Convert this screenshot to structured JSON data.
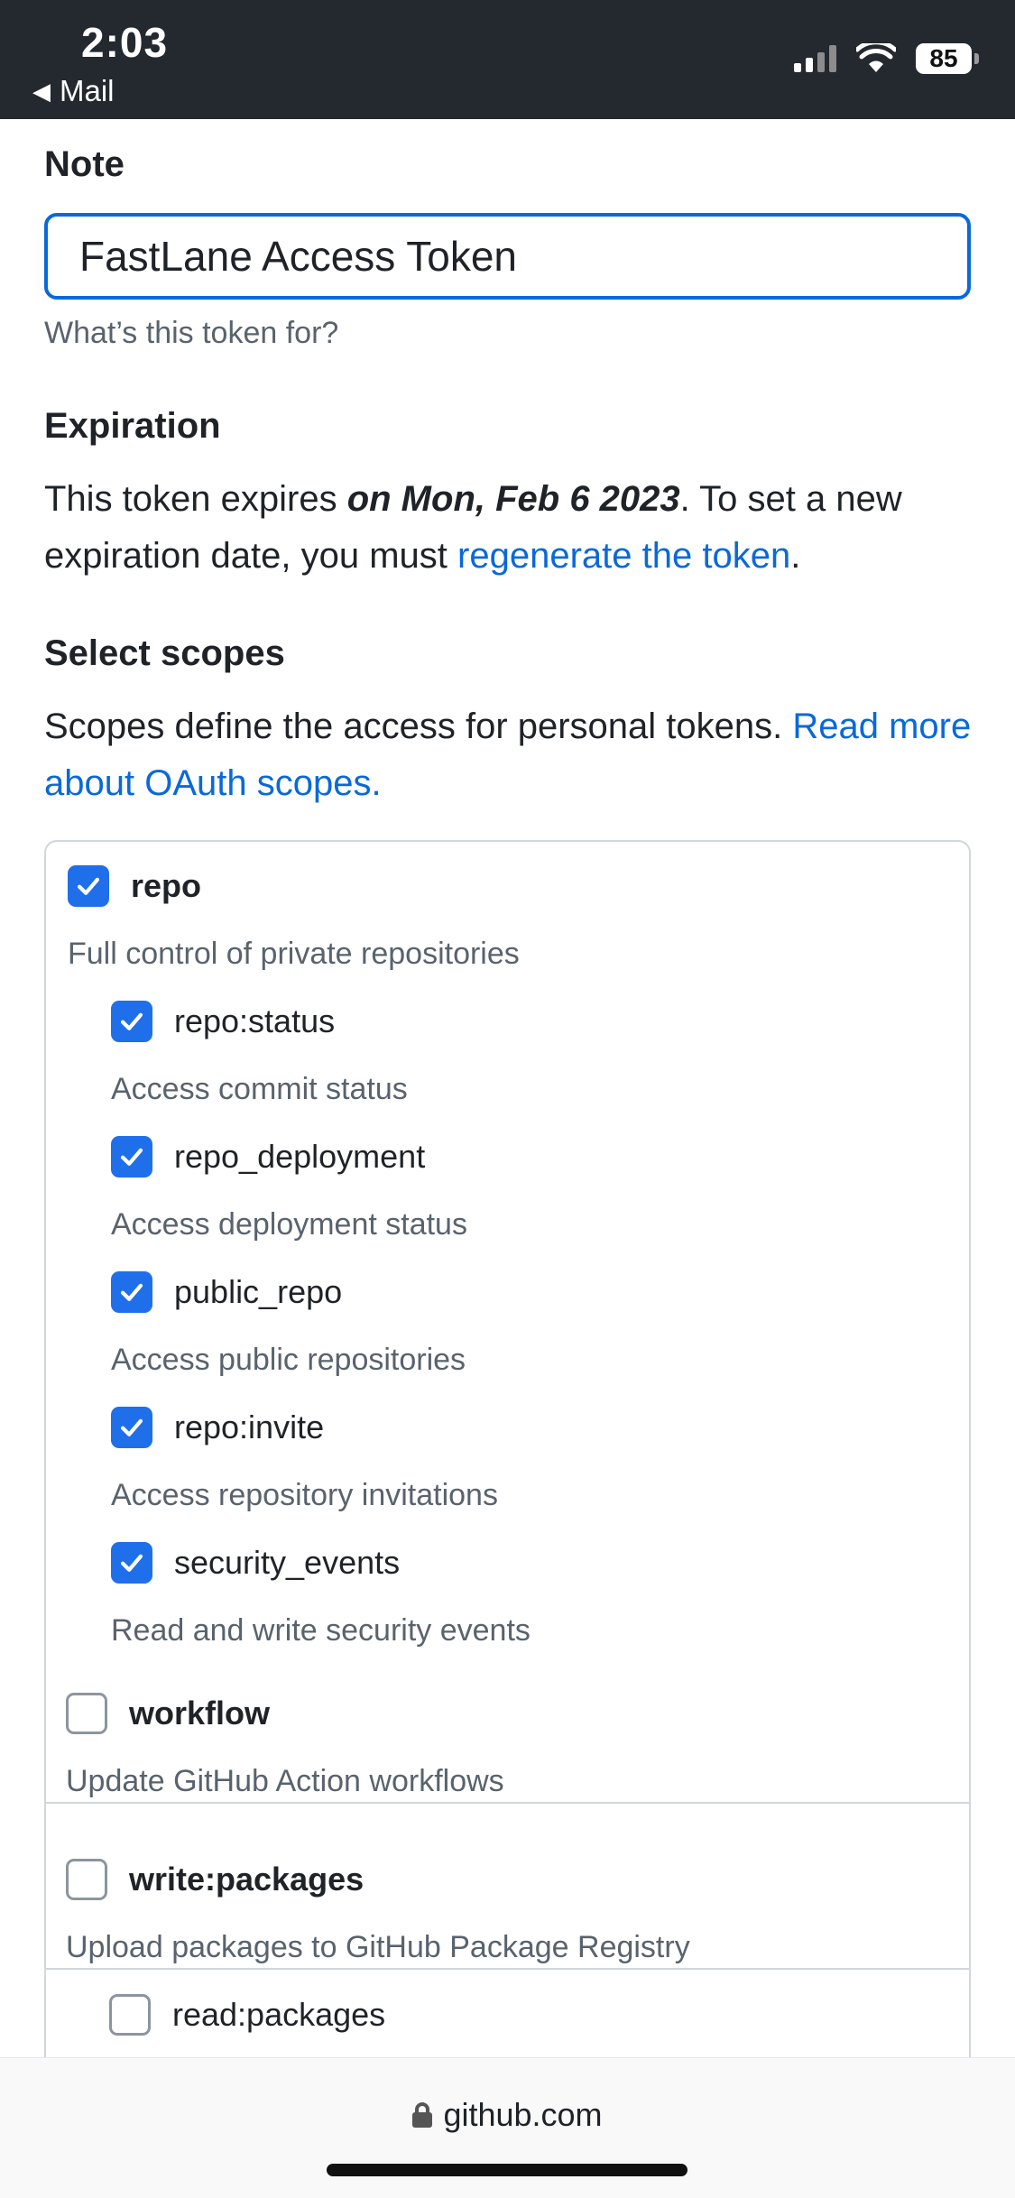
{
  "status_bar": {
    "time": "2:03",
    "back_label": "Mail",
    "battery": "85"
  },
  "note": {
    "label": "Note",
    "value": "FastLane Access Token",
    "hint": "What’s this token for?"
  },
  "expiration": {
    "label": "Expiration",
    "text_before": "This token expires ",
    "date": "on Mon, Feb 6 2023",
    "text_after": ". To set a new expiration date, you must ",
    "link": "regenerate the token",
    "period": "."
  },
  "scopes": {
    "label": "Select scopes",
    "text": "Scopes define the access for personal tokens. ",
    "link": "Read more about OAuth scopes.",
    "items": [
      {
        "name": "repo",
        "desc": "Full control of private repositories",
        "checked": true
      },
      {
        "name": "repo:status",
        "desc": "Access commit status",
        "checked": true
      },
      {
        "name": "repo_deployment",
        "desc": "Access deployment status",
        "checked": true
      },
      {
        "name": "public_repo",
        "desc": "Access public repositories",
        "checked": true
      },
      {
        "name": "repo:invite",
        "desc": "Access repository invitations",
        "checked": true
      },
      {
        "name": "security_events",
        "desc": "Read and write security events",
        "checked": true
      },
      {
        "name": "workflow",
        "desc": "Update GitHub Action workflows",
        "checked": false
      },
      {
        "name": "write:packages",
        "desc": "Upload packages to GitHub Package Registry",
        "checked": false
      },
      {
        "name": "read:packages",
        "desc": "",
        "checked": false
      }
    ]
  },
  "url_bar": {
    "domain": "github.com"
  }
}
